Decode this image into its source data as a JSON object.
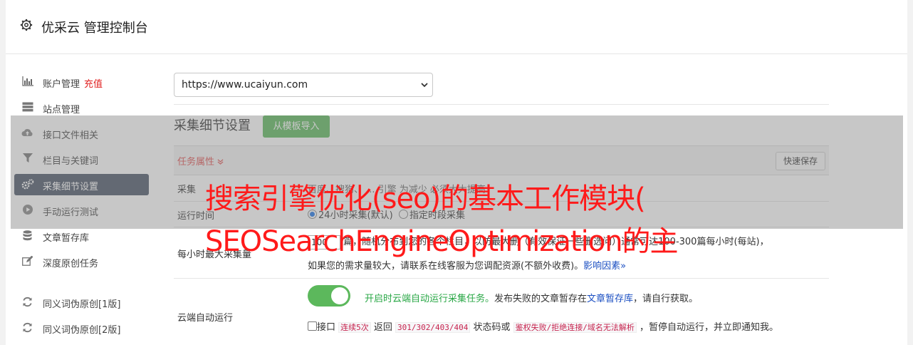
{
  "header": {
    "title": "优采云 管理控制台"
  },
  "sidebar": {
    "items": [
      {
        "label": "账户管理",
        "badge": "充值",
        "icon": "bar-chart-icon"
      },
      {
        "label": "站点管理",
        "icon": "server-icon"
      },
      {
        "label": "接口文件相关",
        "icon": "cloud-upload-icon"
      },
      {
        "label": "栏目与关键词",
        "icon": "filter-icon"
      },
      {
        "label": "采集细节设置",
        "icon": "gears-icon",
        "active": true
      },
      {
        "label": "手动运行测试",
        "icon": "play-circle-icon"
      },
      {
        "label": "文章暂存库",
        "icon": "database-icon"
      },
      {
        "label": "深度原创任务",
        "icon": "edit-icon"
      },
      {
        "label": "同义词伪原创[1版]",
        "icon": "refresh-icon"
      },
      {
        "label": "同义词伪原创[2版]",
        "icon": "refresh-icon"
      }
    ]
  },
  "site_select": {
    "value": "https://www.ucaiyun.com"
  },
  "section": {
    "title": "采集细节设置",
    "import_button": "从模板导入"
  },
  "table": {
    "task_attr": "任务属性 ",
    "quick_save": "快速保存",
    "row_source": {
      "key": "采集",
      "value": "百度、搜狗、  ...  引擎  为减少  必须大大提高"
    },
    "row_runtime": {
      "key": "运行时间",
      "opt1": "24小时采集(默认)",
      "opt2": "指定时段采集"
    },
    "row_max": {
      "key": "每小时最大采集量",
      "num": "100",
      "line1": "篇，随机分布到您的各个栏目，以防最大删（有效保证一些删选问）通常可达100-300篇每小时(每站)，",
      "line2a": "如果您的需求量较大，请联系在线客服为您调配资源(不额外收费)。",
      "line2link": "影响因素"
    },
    "row_cloud": {
      "key": "云端自动运行",
      "line1green": "开启时云端自动运行采集任务。",
      "line1b": "发布失败的文章暂存在",
      "line1link": "文章暂存库",
      "line1c": "，请自行获取。",
      "l2a": "接口",
      "l2code1": "连续5次",
      "l2b": " 返回 ",
      "l2code2": "301/302/403/404",
      "l2c": " 状态码或 ",
      "l2code3": "鉴权失败/拒绝连接/域名无法解析",
      "l2d": " ，暂停自动运行，并立即通知我。"
    }
  },
  "overlay": {
    "line1": "搜索引擎优化(seo)的基本工作模块(",
    "line2": "SEOSearchEngineOptimization的主"
  },
  "colors": {
    "accent_green": "#5cb85c",
    "active_nav": "#4a5566",
    "overlay_text": "#ff1a1a"
  }
}
